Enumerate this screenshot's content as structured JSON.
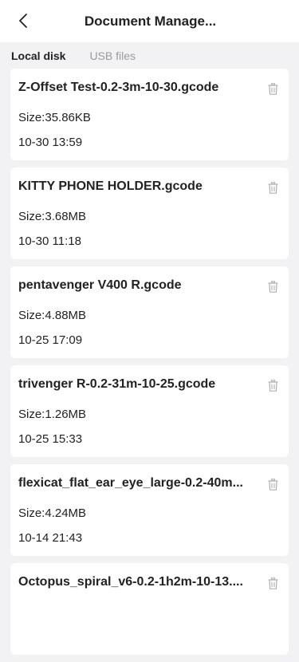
{
  "header": {
    "title": "Document Manage..."
  },
  "tabs": [
    {
      "label": "Local disk",
      "active": true
    },
    {
      "label": "USB files",
      "active": false
    }
  ],
  "files": [
    {
      "name": "Z-Offset Test-0.2-3m-10-30.gcode",
      "size": "Size:35.86KB",
      "date": "10-30 13:59"
    },
    {
      "name": "KITTY PHONE HOLDER.gcode",
      "size": "Size:3.68MB",
      "date": "10-30 11:18"
    },
    {
      "name": "pentavenger V400 R.gcode",
      "size": "Size:4.88MB",
      "date": "10-25 17:09"
    },
    {
      "name": "trivenger R-0.2-31m-10-25.gcode",
      "size": "Size:1.26MB",
      "date": "10-25 15:33"
    },
    {
      "name": "flexicat_flat_ear_eye_large-0.2-40m...",
      "size": "Size:4.24MB",
      "date": "10-14 21:43"
    },
    {
      "name": "Octopus_spiral_v6-0.2-1h2m-10-13....",
      "size": "",
      "date": ""
    }
  ],
  "icons": {
    "back": "chevron-left-icon",
    "delete": "trash-icon"
  },
  "colors": {
    "background": "#f2f2f4",
    "card": "#ffffff",
    "text": "#222222",
    "inactive_tab": "#9a9a9a",
    "icon_gray": "#b0b0b0"
  }
}
